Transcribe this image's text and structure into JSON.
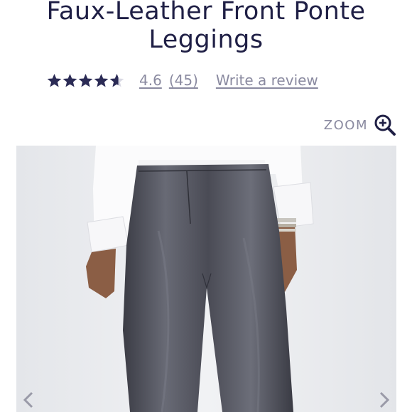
{
  "product": {
    "title_line1": "Faux-Leather Front Ponte",
    "title_line2": "Leggings"
  },
  "rating": {
    "stars": 4.6,
    "value": "4.6",
    "count": "(45)",
    "write_review": "Write a review"
  },
  "zoom": {
    "label": "ZOOM",
    "icon": "zoom-in-icon"
  },
  "gallery": {
    "image": "product-photo-faux-leather-leggings",
    "prev_icon": "chevron-left-icon",
    "next_icon": "chevron-right-icon"
  },
  "colors": {
    "text": "#1f1f45",
    "muted": "#8a8aa0",
    "star": "#2b2b55",
    "photo_bg": "#eceef1"
  }
}
